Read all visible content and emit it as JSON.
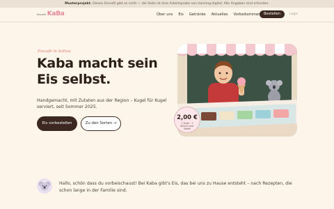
{
  "banner": {
    "label": "Musterprojekt.",
    "text": "Dieses Eiscafé gibt es nicht — die Seite ist eine Arbeitsprobe von hanning.digital. Alle Angaben sind erfunden."
  },
  "brand": {
    "sub": "Eiscafé",
    "name": "KaBa"
  },
  "nav": {
    "items": [
      "Über uns",
      "Eis",
      "Getränke",
      "Aktuelles",
      "Vorbeikommen"
    ],
    "order_label": "Bestellen",
    "login_label": "Login"
  },
  "hero": {
    "tagline": "Eiscafé in Soltau",
    "headline": "Kaba macht sein Eis selbst.",
    "lead": "Handgemacht, mit Zutaten aus der Region – Kugel für Kugel serviert, seit Sommer 2025.",
    "cta_primary": "Eis vorbestellen",
    "cta_secondary": "Zu den Sorten →"
  },
  "price_badge": {
    "value": "2,00 €",
    "note": "1 Kugel · 1 Becher oder Waffel"
  },
  "welcome": {
    "text": "Hallo, schön dass du vorbeischaust! Bei Kaba gibt's Eis, das bei uns zu Hause entsteht – nach Rezepten, die schon lange in der Familie sind."
  },
  "colors": {
    "accent": "#e48a9a",
    "dark": "#3c2820",
    "background": "#fdf5ea",
    "tagline": "#e07a6a"
  }
}
